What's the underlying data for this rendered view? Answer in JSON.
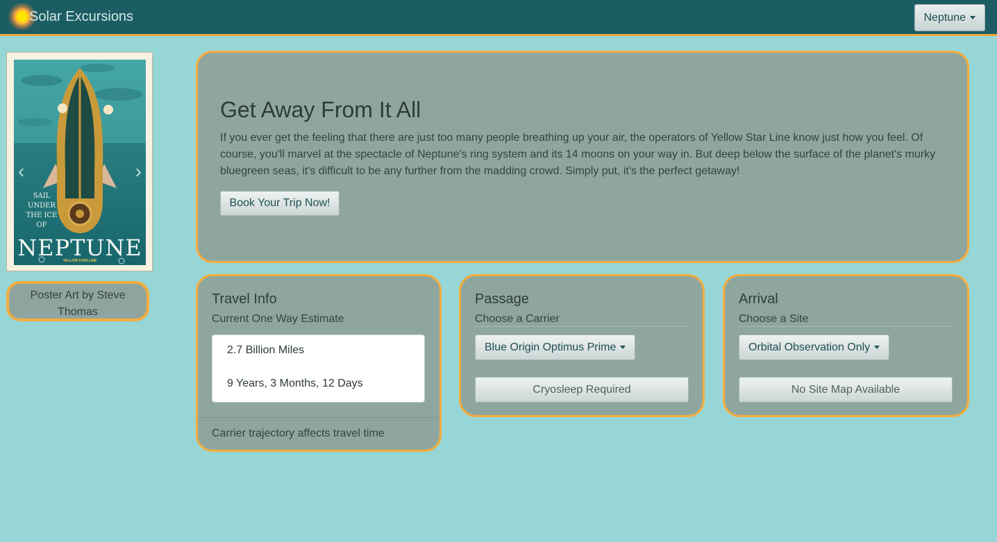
{
  "navbar": {
    "brand": "Solar Excursions",
    "planet_select": "Neptune"
  },
  "poster": {
    "small_text": "SAIL\nUNDER\nTHE ICE\nOF",
    "title": "NEPTUNE",
    "line": "YELLOW STAR LINE",
    "credit": "Poster Art by  Steve Thomas"
  },
  "hero": {
    "title": "Get Away From It All",
    "text": "If you ever get the feeling that there are just too many people breathing up your air, the operators of Yellow Star Line know just how you feel. Of course, you'll marvel at the spectacle of Neptune's ring system and its 14 moons on your way in. But deep below the surface of the planet's murky bluegreen seas, it's difficult to be any further from the madding crowd. Simply put, it's the perfect getaway!",
    "button": "Book Your Trip Now!"
  },
  "travel_info": {
    "title": "Travel Info",
    "subtitle": "Current One Way Estimate",
    "distance": "2.7 Billion Miles",
    "duration": "9 Years, 3 Months, 12 Days",
    "footer": "Carrier trajectory affects travel time"
  },
  "passage": {
    "title": "Passage",
    "subtitle": "Choose a Carrier",
    "carrier": "Blue Origin Optimus Prime",
    "status_button": "Cryosleep Required"
  },
  "arrival": {
    "title": "Arrival",
    "subtitle": "Choose a Site",
    "site": "Orbital Observation Only",
    "status_button": "No Site Map Available"
  }
}
